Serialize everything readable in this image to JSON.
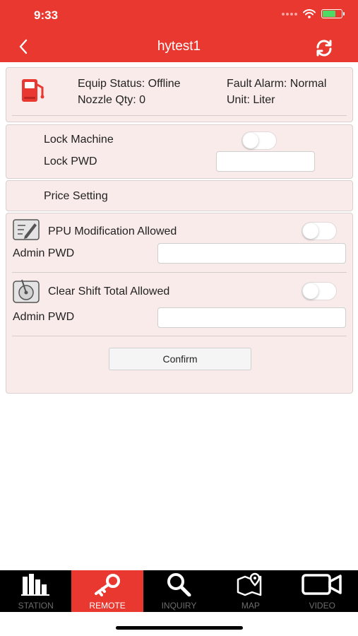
{
  "status_bar": {
    "time": "9:33"
  },
  "header": {
    "title": "hytest1"
  },
  "info_card": {
    "equip_status": "Equip Status: Offline",
    "fault_alarm": "Fault Alarm: Normal",
    "nozzle_qty": "Nozzle Qty: 0",
    "unit": "Unit: Liter"
  },
  "lock_card": {
    "lock_machine_label": "Lock Machine",
    "lock_machine_on": false,
    "lock_pwd_label": "Lock PWD",
    "lock_pwd_value": ""
  },
  "price_setting": {
    "label": "Price Setting"
  },
  "permissions": {
    "ppu_label": "PPU Modification Allowed",
    "ppu_on": false,
    "ppu_admin_pwd_label": "Admin PWD",
    "ppu_admin_pwd_value": "",
    "shift_label": "Clear Shift Total Allowed",
    "shift_on": false,
    "shift_admin_pwd_label": "Admin PWD",
    "shift_admin_pwd_value": "",
    "confirm_label": "Confirm"
  },
  "tabbar": {
    "active": "remote",
    "tabs": [
      {
        "id": "station",
        "label": "STATION",
        "icon": "bar-chart-icon"
      },
      {
        "id": "remote",
        "label": "REMOTE",
        "icon": "key-icon"
      },
      {
        "id": "inquiry",
        "label": "INQUIRY",
        "icon": "magnifier-icon"
      },
      {
        "id": "map",
        "label": "MAP",
        "icon": "map-pin-icon"
      },
      {
        "id": "video",
        "label": "VIDEO",
        "icon": "video-camera-icon"
      }
    ]
  },
  "colors": {
    "primary": "#e8382f",
    "card_bg": "#f9ebea",
    "tabbar_bg": "#000000"
  }
}
